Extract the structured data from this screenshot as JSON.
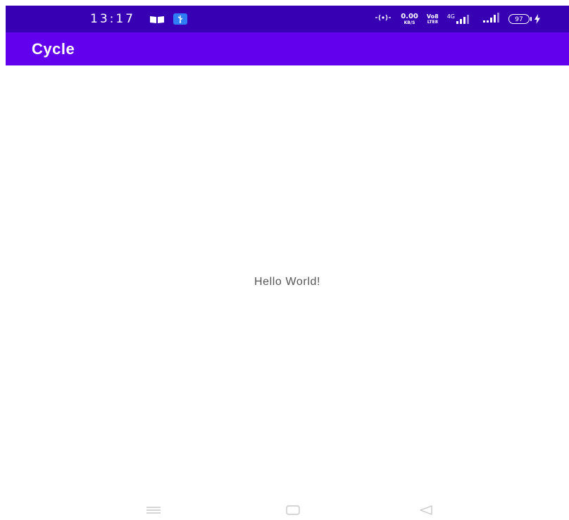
{
  "status_bar": {
    "time": "13:17",
    "net_speed_value": "0.00",
    "net_speed_unit": "KB/S",
    "volte_top": "Vo8",
    "volte_bottom": "LTE8",
    "network_type": "4G",
    "battery_level": "97",
    "colors": {
      "background": "#3700b3",
      "usb_icon": "#2f7df6"
    }
  },
  "app_bar": {
    "title": "Cycle",
    "color": "#6200ee"
  },
  "content": {
    "message": "Hello World!"
  },
  "nav_bar": {
    "icons": [
      "menu-icon",
      "home-icon",
      "back-icon"
    ]
  }
}
